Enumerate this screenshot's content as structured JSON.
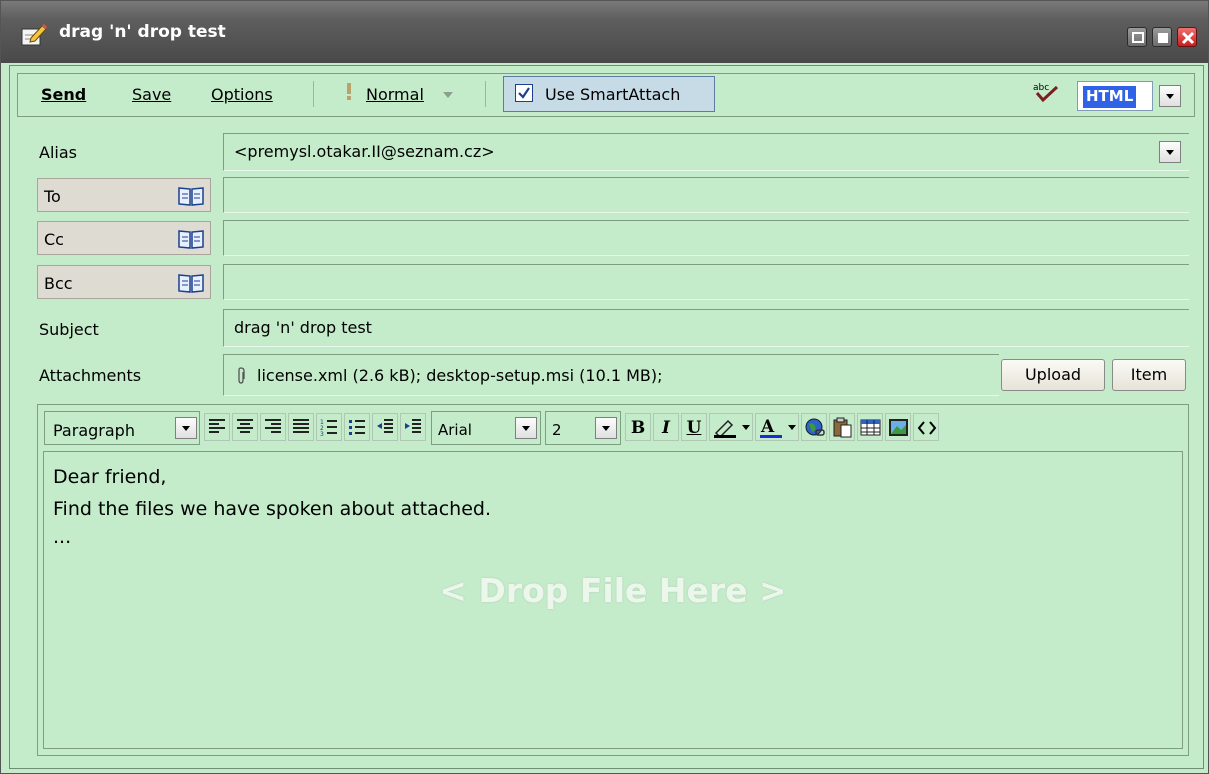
{
  "window": {
    "title": "drag 'n' drop test",
    "icon": "compose-pencil-icon",
    "controls": [
      "minimize-icon",
      "maximize-icon",
      "close-icon"
    ]
  },
  "toolbar": {
    "send_label": "Send",
    "save_label": "Save",
    "options_label": "Options",
    "priority_label": "Normal",
    "smartattach_label": "Use SmartAttach",
    "smartattach_checked": true,
    "format_value": "HTML"
  },
  "fields": {
    "alias_label": "Alias",
    "alias_value": "<premysl.otakar.II@seznam.cz>",
    "to_label": "To",
    "to_value": "",
    "cc_label": "Cc",
    "cc_value": "",
    "bcc_label": "Bcc",
    "bcc_value": "",
    "subject_label": "Subject",
    "subject_value": "drag 'n' drop test",
    "attachments_label": "Attachments",
    "attachments_value": "license.xml (2.6 kB); desktop-setup.msi (10.1 MB);",
    "upload_label": "Upload",
    "item_label": "Item"
  },
  "editor": {
    "paragraph_style": "Paragraph",
    "font_family": "Arial",
    "font_size": "2",
    "bold_label": "B",
    "italic_label": "I",
    "underline_label": "U",
    "font_color": "#1a2ed6",
    "body_lines": [
      "Dear friend,",
      "Find the files we have spoken about attached.",
      "..."
    ],
    "drop_hint": "< Drop File Here >"
  },
  "colors": {
    "background": "#c4ecca",
    "titlebar": "#5e5e5e",
    "highlight": "#2f62e6"
  }
}
